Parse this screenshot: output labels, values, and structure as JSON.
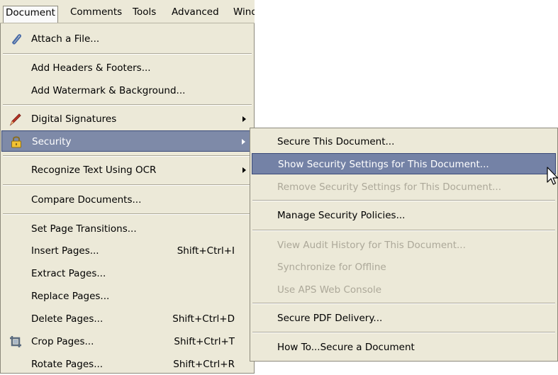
{
  "menubar": {
    "items": [
      "Document",
      "Comments",
      "Tools",
      "Advanced",
      "Wind"
    ]
  },
  "document_menu": {
    "attach_file": "Attach a File...",
    "headers_footers": "Add Headers & Footers...",
    "watermark_background": "Add Watermark & Background...",
    "digital_signatures": "Digital Signatures",
    "security": "Security",
    "recognize_ocr": "Recognize Text Using OCR",
    "compare_documents": "Compare Documents...",
    "set_page_transitions": "Set Page Transitions...",
    "insert_pages": {
      "label": "Insert Pages...",
      "shortcut": "Shift+Ctrl+I"
    },
    "extract_pages": "Extract Pages...",
    "replace_pages": "Replace Pages...",
    "delete_pages": {
      "label": "Delete Pages...",
      "shortcut": "Shift+Ctrl+D"
    },
    "crop_pages": {
      "label": "Crop Pages...",
      "shortcut": "Shift+Ctrl+T"
    },
    "rotate_pages": {
      "label": "Rotate Pages...",
      "shortcut": "Shift+Ctrl+R"
    }
  },
  "security_submenu": {
    "secure_document": "Secure This Document...",
    "show_security_settings": "Show Security Settings for This Document...",
    "remove_security_settings": "Remove Security Settings for This Document...",
    "manage_policies": "Manage Security Policies...",
    "view_audit_history": "View Audit History for This Document...",
    "synchronize_offline": "Synchronize for Offline",
    "use_aps_console": "Use APS Web Console",
    "secure_pdf_delivery": "Secure PDF Delivery...",
    "how_to_secure": "How To...Secure a Document"
  },
  "icons": {
    "attach": "paperclip-icon",
    "signatures": "pen-icon",
    "security": "padlock-icon",
    "crop": "crop-icon",
    "cursor": "mouse-pointer-icon"
  },
  "colors": {
    "menu_bg": "#ece9d8",
    "highlight": "#7e8aa8",
    "disabled_text": "#aca899"
  }
}
